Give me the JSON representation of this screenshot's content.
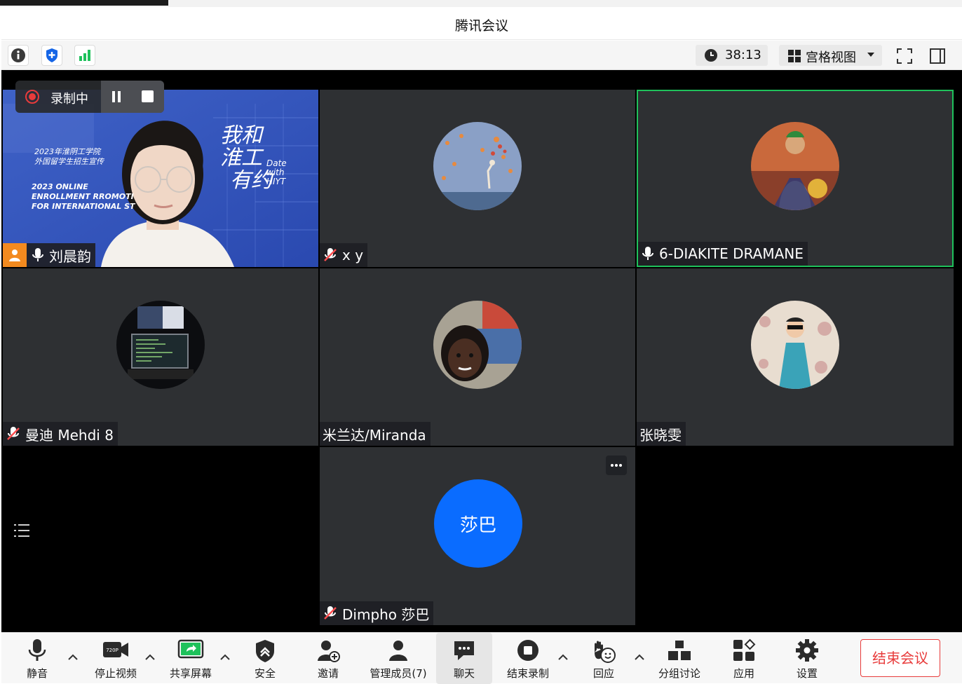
{
  "window": {
    "title": "腾讯会议"
  },
  "toolbar": {
    "timer": "38:13",
    "view_label": "宫格视图"
  },
  "recording": {
    "label": "录制中"
  },
  "participants": [
    {
      "name": "刘晨韵",
      "mic": "on",
      "host": true
    },
    {
      "name": "x y",
      "mic": "muted"
    },
    {
      "name": "6-DIAKITE DRAMANE",
      "mic": "on",
      "active": true
    },
    {
      "name": "曼迪 Mehdi 8",
      "mic": "muted"
    },
    {
      "name": "米兰达/Miranda",
      "mic": "none"
    },
    {
      "name": "张晓雯",
      "mic": "none"
    },
    {
      "name": "Dimpho  莎巴",
      "mic": "muted",
      "avatar_text": "莎巴"
    }
  ],
  "presentation": {
    "line1": "2023年淮阴工学院",
    "line2": "外国留学生招生宣传",
    "line3": "2023 ONLINE",
    "line4": "ENROLLMENT RROMOTI",
    "line5": "FOR INTERNATIONAL ST",
    "calligraphy1": "我和",
    "calligraphy2": "淮工",
    "calligraphy3": "有约",
    "en1": "Date",
    "en2": "with",
    "en3": "HIYT"
  },
  "bottombar": {
    "mute": "静音",
    "stop_video": "停止视频",
    "share": "共享屏幕",
    "security": "安全",
    "invite": "邀请",
    "members": "管理成员(7)",
    "chat": "聊天",
    "stop_record": "结束录制",
    "react": "回应",
    "breakout": "分组讨论",
    "apps": "应用",
    "settings": "设置",
    "end_meeting": "结束会议",
    "video_badge": "720P"
  },
  "colors": {
    "accent_green": "#1fc15b",
    "end_red": "#e83b3b",
    "avatar_blue": "#0a6cff",
    "tile_bg": "#2e3033"
  }
}
